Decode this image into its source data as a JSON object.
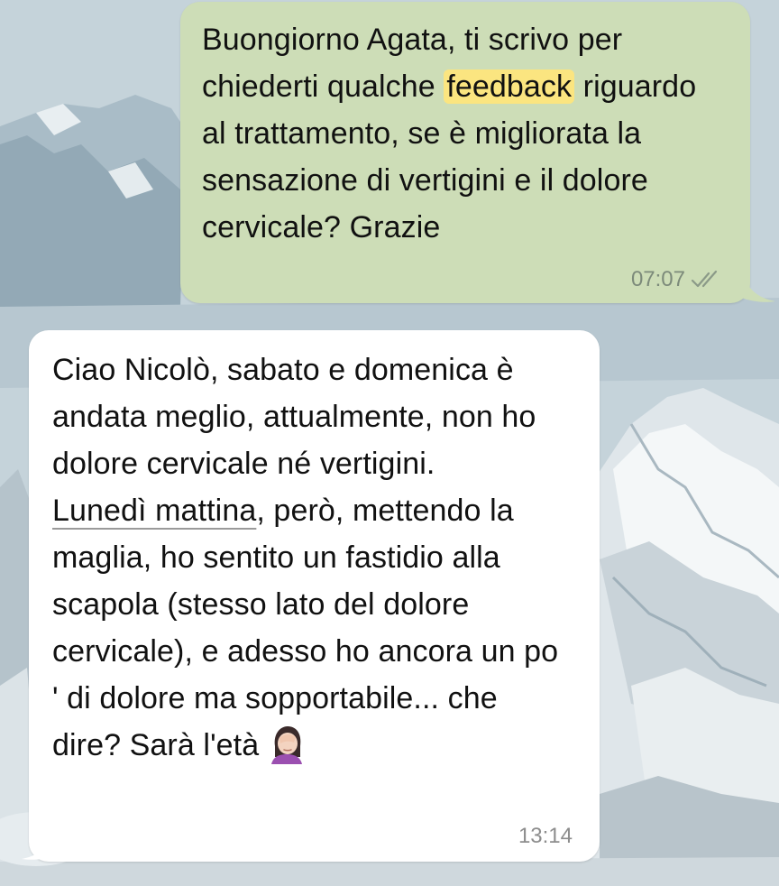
{
  "chat": {
    "outgoing": {
      "line1_pre": "Buongiorno Agata, ti scrivo per chiederti qualche ",
      "highlight": "feedback",
      "line_post": " riguardo al trattamento, se è migliorata la sensazione di vertigini e il dolore cervicale? Grazie",
      "time": "07:07",
      "status_icon": "double-check-icon"
    },
    "incoming": {
      "part1": "Ciao Nicolò,  sabato e domenica è andata meglio, attualmente,  non ho dolore cervicale né vertigini.",
      "underlined": "Lunedì mattina",
      "part2": ",  però, mettendo la maglia, ho sentito un fastidio alla scapola (stesso lato del dolore cervicale), e adesso ho ancora un po ' di dolore ma sopportabile... che dire? Sarà l'età",
      "emoji": "facepalm-woman-emoji",
      "time": "13:14"
    }
  },
  "colors": {
    "outgoing_bubble": "#cdddb7",
    "incoming_bubble": "#ffffff",
    "highlight": "#fbe580"
  }
}
